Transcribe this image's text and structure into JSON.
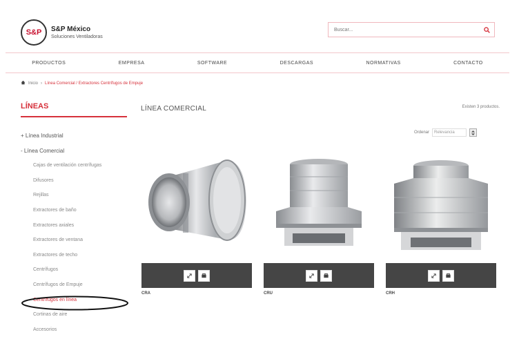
{
  "brand": {
    "logo_text": "S&P",
    "title": "S&P México",
    "subtitle": "Soluciones Ventiladoras"
  },
  "search": {
    "placeholder": "Buscar..."
  },
  "nav": {
    "items": [
      {
        "label": "PRODUCTOS"
      },
      {
        "label": "EMPRESA"
      },
      {
        "label": "SOFTWARE"
      },
      {
        "label": "DESCARGAS"
      },
      {
        "label": "NORMATIVAS"
      },
      {
        "label": "CONTACTO"
      }
    ]
  },
  "breadcrumb": {
    "home": "Inicio",
    "current": "Línea Comercial / Extractores Centrífugos de Empuje"
  },
  "sidebar": {
    "heading": "LÍNEAS",
    "items": [
      {
        "label": "+ Línea Industrial"
      },
      {
        "label": "- Línea Comercial"
      },
      {
        "label": "Cajas de ventilación centrífugas"
      },
      {
        "label": "Difusores"
      },
      {
        "label": "Rejillas"
      },
      {
        "label": "Extractores de baño"
      },
      {
        "label": "Extractores axiales"
      },
      {
        "label": "Extractores de ventana"
      },
      {
        "label": "Extractores de techo"
      },
      {
        "label": "Centrífugos"
      },
      {
        "label": "Centrífugos de Empuje"
      },
      {
        "label": "Centrífugos en línea"
      },
      {
        "label": "Cortinas de aire"
      },
      {
        "label": "Accesorios"
      }
    ]
  },
  "main": {
    "title": "LÍNEA COMERCIAL",
    "count": "Existen 3 productos.",
    "sort_label": "Ordenar",
    "sort_value": "Relevancia"
  },
  "products": [
    {
      "name": "CRA"
    },
    {
      "name": "CRU"
    },
    {
      "name": "CRH"
    }
  ],
  "colors": {
    "accent": "#d6303a",
    "bar": "#454545"
  }
}
